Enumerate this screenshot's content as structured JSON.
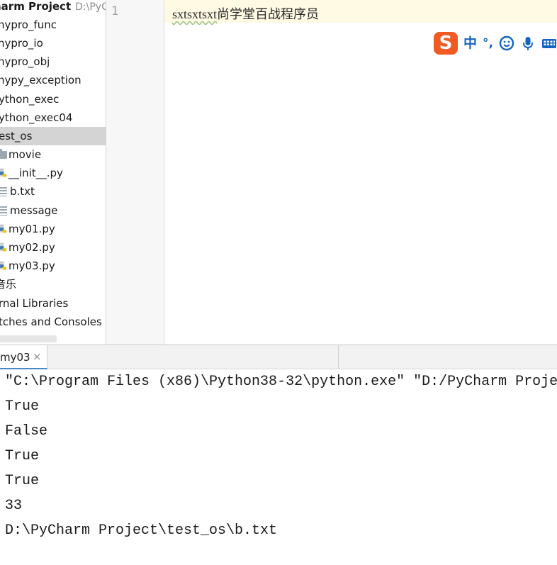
{
  "project": {
    "title": "harm Project",
    "path": "D:\\PyCh"
  },
  "tree": [
    {
      "label": "nypro_func",
      "icon": "none"
    },
    {
      "label": "nypro_io",
      "icon": "none"
    },
    {
      "label": "nypro_obj",
      "icon": "none"
    },
    {
      "label": "nypy_exception",
      "icon": "none"
    },
    {
      "label": "ython_exec",
      "icon": "none"
    },
    {
      "label": "ython_exec04",
      "icon": "none"
    },
    {
      "label": "est_os",
      "icon": "none",
      "selected": true
    },
    {
      "label": "movie",
      "icon": "folder-icon"
    },
    {
      "label": "__init__.py",
      "icon": "python-file-icon"
    },
    {
      "label": "b.txt",
      "icon": "text-file-icon"
    },
    {
      "label": "message",
      "icon": "text-file-icon"
    },
    {
      "label": "my01.py",
      "icon": "python-file-icon"
    },
    {
      "label": "my02.py",
      "icon": "python-file-icon"
    },
    {
      "label": "my03.py",
      "icon": "python-file-icon"
    },
    {
      "label": "音乐",
      "icon": "none"
    },
    {
      "label": "rnal Libraries",
      "icon": "none"
    },
    {
      "label": "tches and Consoles",
      "icon": "none"
    }
  ],
  "editor": {
    "line_number": "1",
    "code_underlined": "sxtsxtsxt",
    "code_rest": "尚学堂百战程序员"
  },
  "ime": {
    "logo": "S",
    "mode": "中",
    "punct": "°,",
    "icons": [
      "emoji-icon",
      "microphone-icon",
      "keyboard-icon"
    ]
  },
  "run": {
    "tab_label": "my03",
    "close_glyph": "×"
  },
  "console": [
    "\"C:\\Program Files (x86)\\Python38-32\\python.exe\" \"D:/PyCharm Proje",
    "True",
    "False",
    "True",
    "True",
    "33",
    "D:\\PyCharm Project\\test_os\\b.txt"
  ],
  "colors": {
    "selection": "#d4d4d4",
    "current_line": "#fffae3",
    "ime_orange": "#f05a24",
    "ime_blue": "#1565c0"
  }
}
